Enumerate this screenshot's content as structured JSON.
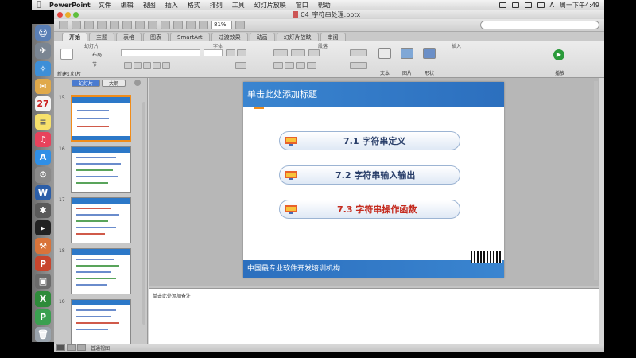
{
  "menubar": {
    "app_name": "PowerPoint",
    "items": [
      "文件",
      "编辑",
      "视图",
      "插入",
      "格式",
      "排列",
      "工具",
      "幻灯片放映",
      "窗口",
      "帮助"
    ],
    "clock": "周一下午4:49",
    "input_method": "A"
  },
  "window": {
    "title": "C4_字符串处理.pptx"
  },
  "toolbar": {
    "zoom": "81%",
    "search_placeholder": ""
  },
  "ribbon_tabs": [
    {
      "label": "开始",
      "active": true
    },
    {
      "label": "主题",
      "active": false
    },
    {
      "label": "表格",
      "active": false
    },
    {
      "label": "图表",
      "active": false
    },
    {
      "label": "SmartArt",
      "active": false
    },
    {
      "label": "过渡效果",
      "active": false
    },
    {
      "label": "动画",
      "active": false
    },
    {
      "label": "幻灯片放映",
      "active": false
    },
    {
      "label": "审阅",
      "active": false
    }
  ],
  "ribbon": {
    "group_slides": "幻灯片",
    "group_font": "字体",
    "group_paragraph": "段落",
    "group_insert": "插入",
    "new_slide": "新建幻灯片",
    "layout": "布局",
    "section": "节",
    "text_label": "文本",
    "picture_label": "图片",
    "shape_label": "形状",
    "play_label": "播放"
  },
  "panel": {
    "tab_slides": "幻灯片",
    "tab_outline": "大纲",
    "slide_numbers": [
      "15",
      "16",
      "17",
      "18",
      "19"
    ]
  },
  "slide": {
    "title": "单击此处添加标题",
    "items": [
      {
        "text": "7.1 字符串定义",
        "color": "#2a3f6a"
      },
      {
        "text": "7.2 字符串输入输出",
        "color": "#2a3f6a"
      },
      {
        "text": "7.3 字符串操作函数",
        "color": "#c42a1e"
      }
    ],
    "footer": "中国最专业软件开发培训机构"
  },
  "notes": {
    "text": "单击此处添加备注"
  },
  "status": {
    "view_text": "普通视图"
  }
}
